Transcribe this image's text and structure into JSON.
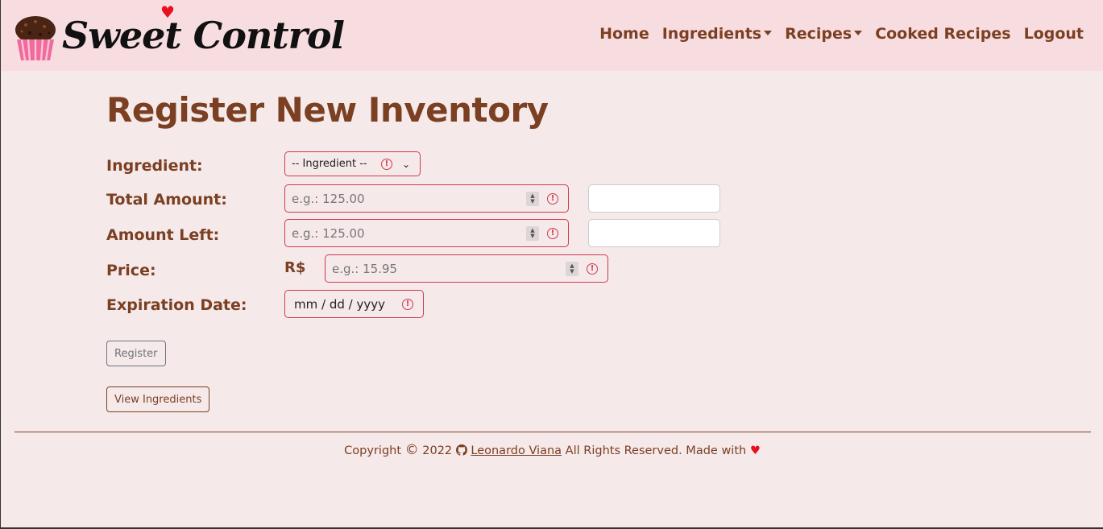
{
  "brand": {
    "name": "Sweet Control"
  },
  "nav": {
    "home": "Home",
    "ingredients": "Ingredients",
    "recipes": "Recipes",
    "cooked_recipes": "Cooked Recipes",
    "logout": "Logout"
  },
  "page": {
    "title": "Register New Inventory"
  },
  "form": {
    "ingredient_label": "Ingredient:",
    "ingredient_selected": "-- Ingredient --",
    "total_amount_label": "Total Amount:",
    "total_amount_placeholder": "e.g.: 125.00",
    "amount_left_label": "Amount Left:",
    "amount_left_placeholder": "e.g.: 125.00",
    "price_label": "Price:",
    "currency": "R$",
    "price_placeholder": "e.g.: 15.95",
    "expiration_label": "Expiration Date:",
    "expiration_value": "mm / dd / yyyy",
    "register_button": "Register",
    "view_button": "View Ingredients"
  },
  "footer": {
    "copyright": "Copyright",
    "year": "2022",
    "author": "Leonardo Viana",
    "rights": "All Rights Reserved. Made with"
  },
  "colors": {
    "accent": "#7b3f22",
    "navbar_bg": "#f8dde0",
    "page_bg": "#f5e9ea",
    "invalid": "#d03a4c",
    "heart": "#e8101e"
  },
  "icons": [
    "cupcake-logo-icon",
    "heart-icon",
    "caret-down-icon",
    "error-icon",
    "spinner-icon",
    "chevron-down-icon",
    "copyright-icon",
    "github-icon"
  ]
}
